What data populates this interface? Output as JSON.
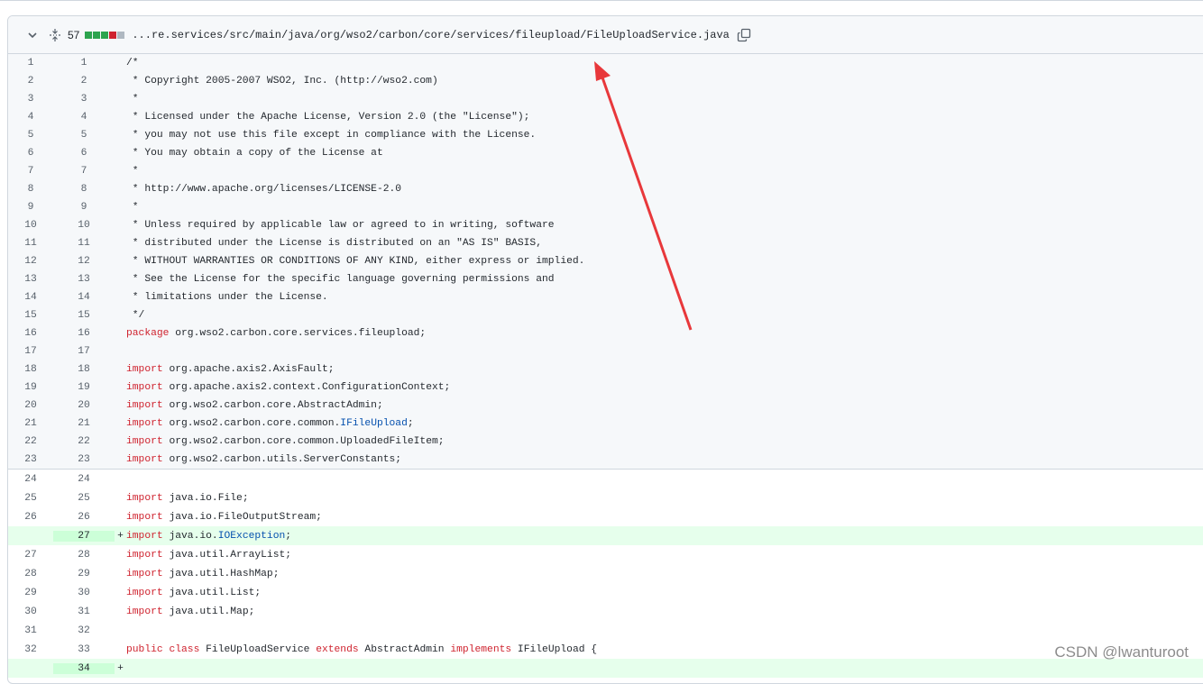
{
  "header": {
    "changes_count": "57",
    "file_path": "...re.services/src/main/java/org/wso2/carbon/core/services/fileupload/FileUploadService.java",
    "diffstat_colors": [
      "#2da44e",
      "#2da44e",
      "#2da44e",
      "#cf222e",
      "#afb8c1"
    ]
  },
  "collapsed_lines": [
    {
      "old": "1",
      "new": "1",
      "mark": "",
      "parts": [
        {
          "t": "/*",
          "c": "c"
        }
      ]
    },
    {
      "old": "2",
      "new": "2",
      "mark": "",
      "parts": [
        {
          "t": " * Copyright 2005-2007 WSO2, Inc. (http://wso2.com)",
          "c": "c"
        }
      ]
    },
    {
      "old": "3",
      "new": "3",
      "mark": "",
      "parts": [
        {
          "t": " *",
          "c": "c"
        }
      ]
    },
    {
      "old": "4",
      "new": "4",
      "mark": "",
      "parts": [
        {
          "t": " * Licensed under the Apache License, Version 2.0 (the \"License\");",
          "c": "c"
        }
      ]
    },
    {
      "old": "5",
      "new": "5",
      "mark": "",
      "parts": [
        {
          "t": " * you may not use this file except in compliance with the License.",
          "c": "c"
        }
      ]
    },
    {
      "old": "6",
      "new": "6",
      "mark": "",
      "parts": [
        {
          "t": " * You may obtain a copy of the License at",
          "c": "c"
        }
      ]
    },
    {
      "old": "7",
      "new": "7",
      "mark": "",
      "parts": [
        {
          "t": " *",
          "c": "c"
        }
      ]
    },
    {
      "old": "8",
      "new": "8",
      "mark": "",
      "parts": [
        {
          "t": " * http://www.apache.org/licenses/LICENSE-2.0",
          "c": "c"
        }
      ]
    },
    {
      "old": "9",
      "new": "9",
      "mark": "",
      "parts": [
        {
          "t": " *",
          "c": "c"
        }
      ]
    },
    {
      "old": "10",
      "new": "10",
      "mark": "",
      "parts": [
        {
          "t": " * Unless required by applicable law or agreed to in writing, software",
          "c": "c"
        }
      ]
    },
    {
      "old": "11",
      "new": "11",
      "mark": "",
      "parts": [
        {
          "t": " * distributed under the License is distributed on an \"AS IS\" BASIS,",
          "c": "c"
        }
      ]
    },
    {
      "old": "12",
      "new": "12",
      "mark": "",
      "parts": [
        {
          "t": " * WITHOUT WARRANTIES OR CONDITIONS OF ANY KIND, either express or implied.",
          "c": "c"
        }
      ]
    },
    {
      "old": "13",
      "new": "13",
      "mark": "",
      "parts": [
        {
          "t": " * See the License for the specific language governing permissions and",
          "c": "c"
        }
      ]
    },
    {
      "old": "14",
      "new": "14",
      "mark": "",
      "parts": [
        {
          "t": " * limitations under the License.",
          "c": "c"
        }
      ]
    },
    {
      "old": "15",
      "new": "15",
      "mark": "",
      "parts": [
        {
          "t": " */",
          "c": "c"
        }
      ]
    },
    {
      "old": "16",
      "new": "16",
      "mark": "",
      "parts": [
        {
          "t": "package",
          "c": "k"
        },
        {
          "t": " org.wso2.carbon.core.services.fileupload;",
          "c": ""
        }
      ]
    },
    {
      "old": "17",
      "new": "17",
      "mark": "",
      "parts": []
    },
    {
      "old": "18",
      "new": "18",
      "mark": "",
      "parts": [
        {
          "t": "import",
          "c": "k"
        },
        {
          "t": " org.apache.axis2.AxisFault;",
          "c": ""
        }
      ]
    },
    {
      "old": "19",
      "new": "19",
      "mark": "",
      "parts": [
        {
          "t": "import",
          "c": "k"
        },
        {
          "t": " org.apache.axis2.context.ConfigurationContext;",
          "c": ""
        }
      ]
    },
    {
      "old": "20",
      "new": "20",
      "mark": "",
      "parts": [
        {
          "t": "import",
          "c": "k"
        },
        {
          "t": " org.wso2.carbon.core.AbstractAdmin;",
          "c": ""
        }
      ]
    },
    {
      "old": "21",
      "new": "21",
      "mark": "",
      "parts": [
        {
          "t": "import",
          "c": "k"
        },
        {
          "t": " org.wso2.carbon.core.common.",
          "c": ""
        },
        {
          "t": "IFileUpload",
          "c": "t"
        },
        {
          "t": ";",
          "c": ""
        }
      ]
    },
    {
      "old": "22",
      "new": "22",
      "mark": "",
      "parts": [
        {
          "t": "import",
          "c": "k"
        },
        {
          "t": " org.wso2.carbon.core.common.UploadedFileItem;",
          "c": ""
        }
      ]
    },
    {
      "old": "23",
      "new": "23",
      "mark": "",
      "parts": [
        {
          "t": "import",
          "c": "k"
        },
        {
          "t": " org.wso2.carbon.utils.ServerConstants;",
          "c": ""
        }
      ]
    }
  ],
  "expanded_lines": [
    {
      "old": "24",
      "new": "24",
      "mark": "",
      "type": "ctx",
      "parts": []
    },
    {
      "old": "25",
      "new": "25",
      "mark": "",
      "type": "ctx",
      "parts": [
        {
          "t": "import",
          "c": "k"
        },
        {
          "t": " java.io.File;",
          "c": ""
        }
      ]
    },
    {
      "old": "26",
      "new": "26",
      "mark": "",
      "type": "ctx",
      "parts": [
        {
          "t": "import",
          "c": "k"
        },
        {
          "t": " java.io.FileOutputStream;",
          "c": ""
        }
      ]
    },
    {
      "old": "",
      "new": "27",
      "mark": "+",
      "type": "add",
      "parts": [
        {
          "t": "import",
          "c": "k"
        },
        {
          "t": " java.io.",
          "c": ""
        },
        {
          "t": "IOException",
          "c": "t"
        },
        {
          "t": ";",
          "c": ""
        }
      ]
    },
    {
      "old": "27",
      "new": "28",
      "mark": "",
      "type": "ctx",
      "parts": [
        {
          "t": "import",
          "c": "k"
        },
        {
          "t": " java.util.ArrayList;",
          "c": ""
        }
      ]
    },
    {
      "old": "28",
      "new": "29",
      "mark": "",
      "type": "ctx",
      "parts": [
        {
          "t": "import",
          "c": "k"
        },
        {
          "t": " java.util.HashMap;",
          "c": ""
        }
      ]
    },
    {
      "old": "29",
      "new": "30",
      "mark": "",
      "type": "ctx",
      "parts": [
        {
          "t": "import",
          "c": "k"
        },
        {
          "t": " java.util.List;",
          "c": ""
        }
      ]
    },
    {
      "old": "30",
      "new": "31",
      "mark": "",
      "type": "ctx",
      "parts": [
        {
          "t": "import",
          "c": "k"
        },
        {
          "t": " java.util.Map;",
          "c": ""
        }
      ]
    },
    {
      "old": "31",
      "new": "32",
      "mark": "",
      "type": "ctx",
      "parts": []
    },
    {
      "old": "32",
      "new": "33",
      "mark": "",
      "type": "ctx",
      "parts": [
        {
          "t": "public",
          "c": "k"
        },
        {
          "t": " ",
          "c": ""
        },
        {
          "t": "class",
          "c": "k"
        },
        {
          "t": " FileUploadService ",
          "c": ""
        },
        {
          "t": "extends",
          "c": "k"
        },
        {
          "t": " AbstractAdmin ",
          "c": ""
        },
        {
          "t": "implements",
          "c": "k"
        },
        {
          "t": " IFileUpload {",
          "c": ""
        }
      ]
    },
    {
      "old": "",
      "new": "34",
      "mark": "+",
      "type": "add",
      "parts": []
    }
  ],
  "watermark": "CSDN @lwanturoot",
  "colors": {
    "keyword": "#cf222e",
    "type": "#0550ae",
    "comment": "#24292f",
    "arrow": "#e8383b"
  }
}
